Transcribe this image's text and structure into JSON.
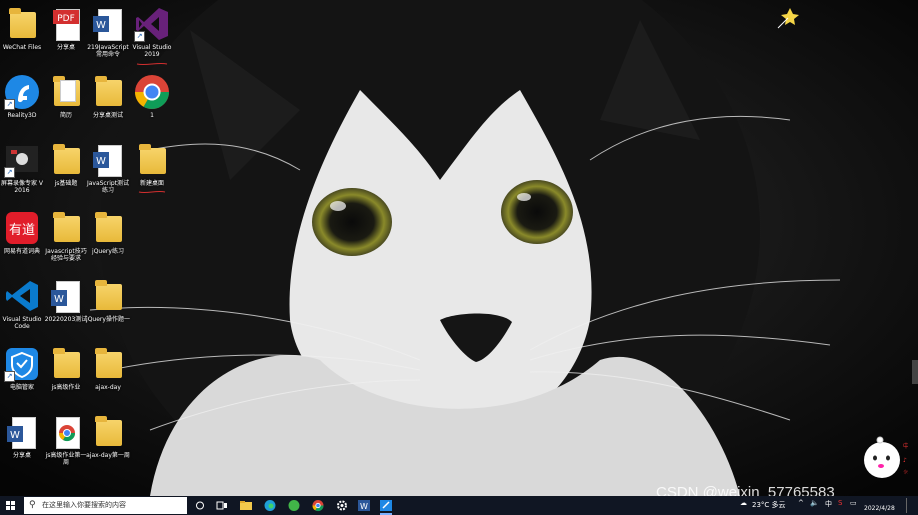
{
  "desktop": {
    "icons": [
      {
        "label": "WeChat Files"
      },
      {
        "label": "分享桌"
      },
      {
        "label": "219JavaScript 常用命令"
      },
      {
        "label": "Visual Studio 2019"
      },
      {
        "label": "Reality3D"
      },
      {
        "label": "简历"
      },
      {
        "label": "分享桌测试"
      },
      {
        "label": "1"
      },
      {
        "label": "屏幕录像专家 V2016"
      },
      {
        "label": "js基础题"
      },
      {
        "label": "JavaScript测试 练习"
      },
      {
        "label": "新建桌面"
      },
      {
        "label": "网易有道词典"
      },
      {
        "label": "Javascript技巧 经验与要求"
      },
      {
        "label": "jQuery练习"
      },
      {
        "label": "Visual Studio Code"
      },
      {
        "label": "20220203测试"
      },
      {
        "label": "jQuery操作题一"
      },
      {
        "label": "电脑管家"
      },
      {
        "label": "js高级作业"
      },
      {
        "label": "ajax-day"
      },
      {
        "label": "分享桌"
      },
      {
        "label": "js高级作业第一周"
      },
      {
        "label": "ajax-day第一周"
      }
    ]
  },
  "taskbar": {
    "search_placeholder": "在这里输入你要搜索的内容",
    "weather": "23°C 多云",
    "ime": "中",
    "date": "2022/4/28"
  },
  "watermark": "CSDN @weixin_57765583",
  "colors": {
    "taskbar_bg": "#101623",
    "folder": "#f2c94c",
    "vs_purple": "#68217a",
    "vscode_blue": "#0a7acc",
    "youdao_red": "#e11d2a"
  }
}
